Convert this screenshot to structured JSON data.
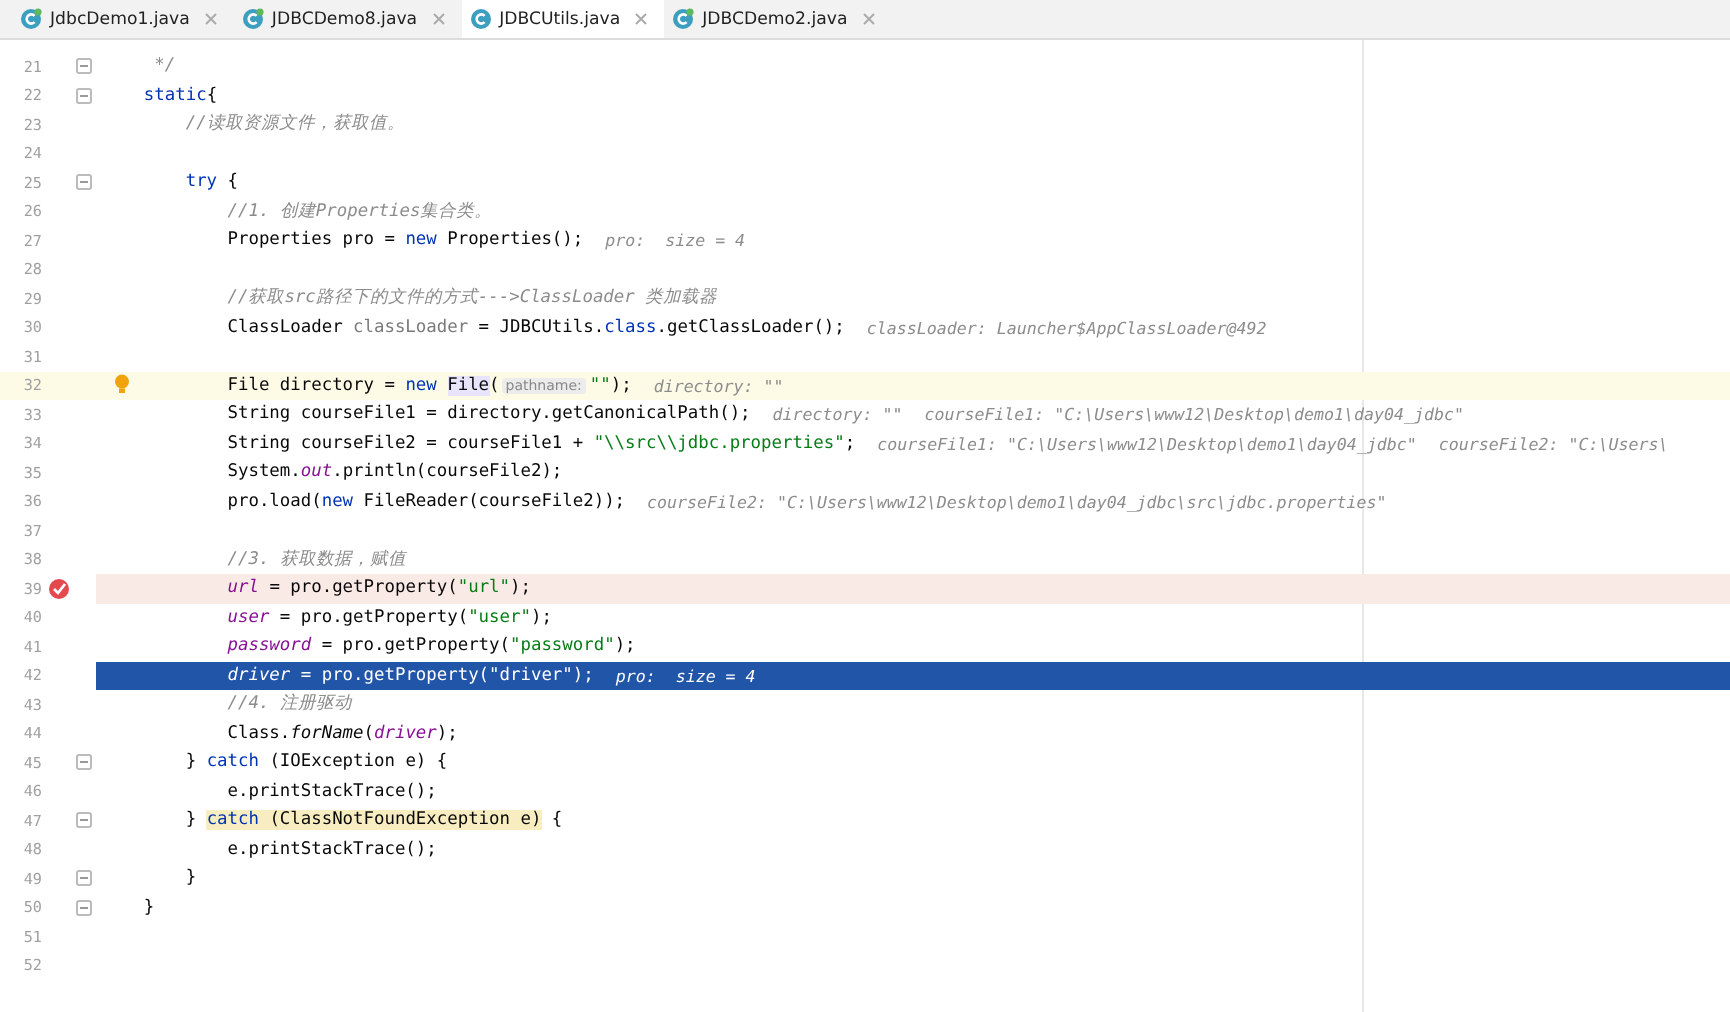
{
  "tabs": [
    {
      "label": "JdbcDemo1.java",
      "selected": false
    },
    {
      "label": "JDBCDemo8.java",
      "selected": false
    },
    {
      "label": "JDBCUtils.java",
      "selected": true
    },
    {
      "label": "JDBCDemo2.java",
      "selected": false
    }
  ],
  "lines": [
    {
      "number": "21",
      "fold": true,
      "tokens": [
        {
          "kind": "comment",
          "text": "     */"
        }
      ]
    },
    {
      "number": "22",
      "fold": true,
      "tokens": [
        {
          "kind": "keyword",
          "text": "    static"
        },
        {
          "kind": "plain",
          "text": "{"
        }
      ]
    },
    {
      "number": "23",
      "tokens": [
        {
          "kind": "comment",
          "text": "        //读取资源文件，获取值。"
        }
      ]
    },
    {
      "number": "24"
    },
    {
      "number": "25",
      "fold": true,
      "tokens": [
        {
          "kind": "keyword",
          "text": "        try"
        },
        {
          "kind": "plain",
          "text": " {"
        }
      ]
    },
    {
      "number": "26",
      "tokens": [
        {
          "kind": "comment",
          "text": "            //1. 创建Properties集合类。"
        }
      ]
    },
    {
      "number": "27",
      "tokens": [
        {
          "kind": "plain",
          "text": "            Properties pro = "
        },
        {
          "kind": "keyword",
          "text": "new"
        },
        {
          "kind": "plain",
          "text": " Properties();"
        },
        {
          "kind": "hint",
          "text": "pro:  size = 4"
        }
      ]
    },
    {
      "number": "28"
    },
    {
      "number": "29",
      "tokens": [
        {
          "kind": "comment",
          "text": "            //获取src路径下的文件的方式--->ClassLoader 类加载器"
        }
      ]
    },
    {
      "number": "30",
      "tokens": [
        {
          "kind": "plain",
          "text": "            ClassLoader "
        },
        {
          "kind": "unused",
          "text": "classLoader"
        },
        {
          "kind": "plain",
          "text": " = JDBCUtils."
        },
        {
          "kind": "keyword",
          "text": "class"
        },
        {
          "kind": "plain",
          "text": ".getClassLoader();"
        },
        {
          "kind": "hint",
          "text": "classLoader: Launcher$AppClassLoader@492"
        }
      ]
    },
    {
      "number": "31"
    },
    {
      "number": "32",
      "caret_line": true,
      "bulb": true,
      "tokens": [
        {
          "kind": "plain",
          "text": "            File directory = "
        },
        {
          "kind": "keyword",
          "text": "new "
        },
        {
          "kind": "match",
          "text": "File"
        },
        {
          "kind": "plain",
          "text": "("
        },
        {
          "kind": "param",
          "text": "pathname:"
        },
        {
          "kind": "string",
          "text": "\"\""
        },
        {
          "kind": "plain",
          "text": ");"
        },
        {
          "kind": "hint",
          "text": "directory: \"\""
        }
      ]
    },
    {
      "number": "33",
      "tokens": [
        {
          "kind": "plain",
          "text": "            String courseFile1 = directory.getCanonicalPath();"
        },
        {
          "kind": "hint",
          "text": "directory: \"\""
        },
        {
          "kind": "hint",
          "text": "courseFile1: \"C:\\Users\\www12\\Desktop\\demo1\\day04_jdbc\""
        }
      ]
    },
    {
      "number": "34",
      "tokens": [
        {
          "kind": "plain",
          "text": "            String courseFile2 = courseFile1 + "
        },
        {
          "kind": "string",
          "text": "\"\\\\src\\\\jdbc.properties\""
        },
        {
          "kind": "plain",
          "text": ";"
        },
        {
          "kind": "hint",
          "text": "courseFile1: \"C:\\Users\\www12\\Desktop\\demo1\\day04_jdbc\""
        },
        {
          "kind": "hint",
          "text": "courseFile2: \"C:\\Users\\"
        }
      ]
    },
    {
      "number": "35",
      "tokens": [
        {
          "kind": "plain",
          "text": "            System."
        },
        {
          "kind": "field",
          "text": "out"
        },
        {
          "kind": "plain",
          "text": ".println(courseFile2);"
        }
      ]
    },
    {
      "number": "36",
      "tokens": [
        {
          "kind": "plain",
          "text": "            pro.load("
        },
        {
          "kind": "keyword",
          "text": "new"
        },
        {
          "kind": "plain",
          "text": " FileReader(courseFile2));"
        },
        {
          "kind": "hint",
          "text": "courseFile2: \"C:\\Users\\www12\\Desktop\\demo1\\day04_jdbc\\src\\jdbc.properties\""
        }
      ]
    },
    {
      "number": "37"
    },
    {
      "number": "38",
      "tokens": [
        {
          "kind": "comment",
          "text": "            //3. 获取数据，赋值"
        }
      ]
    },
    {
      "number": "39",
      "breakpoint": true,
      "tokens": [
        {
          "kind": "field",
          "text": "            url"
        },
        {
          "kind": "plain",
          "text": " = pro.getProperty("
        },
        {
          "kind": "string",
          "text": "\"url\""
        },
        {
          "kind": "plain",
          "text": ");"
        }
      ]
    },
    {
      "number": "40",
      "tokens": [
        {
          "kind": "field",
          "text": "            user"
        },
        {
          "kind": "plain",
          "text": " = pro.getProperty("
        },
        {
          "kind": "string",
          "text": "\"user\""
        },
        {
          "kind": "plain",
          "text": ");"
        }
      ]
    },
    {
      "number": "41",
      "tokens": [
        {
          "kind": "field",
          "text": "            password"
        },
        {
          "kind": "plain",
          "text": " = pro.getProperty("
        },
        {
          "kind": "string",
          "text": "\"password\""
        },
        {
          "kind": "plain",
          "text": ");"
        }
      ]
    },
    {
      "number": "42",
      "execution_point": true,
      "tokens": [
        {
          "kind": "field",
          "text": "            driver"
        },
        {
          "kind": "plain",
          "text": " = pro.getProperty("
        },
        {
          "kind": "string",
          "text": "\"driver\""
        },
        {
          "kind": "plain",
          "text": ");"
        },
        {
          "kind": "hint",
          "text": "pro:  size = 4"
        }
      ]
    },
    {
      "number": "43",
      "tokens": [
        {
          "kind": "comment",
          "text": "            //4. 注册驱动"
        }
      ]
    },
    {
      "number": "44",
      "tokens": [
        {
          "kind": "plain",
          "text": "            Class."
        },
        {
          "kind": "static",
          "text": "forName"
        },
        {
          "kind": "plain",
          "text": "("
        },
        {
          "kind": "field",
          "text": "driver"
        },
        {
          "kind": "plain",
          "text": ");"
        }
      ]
    },
    {
      "number": "45",
      "fold": true,
      "tokens": [
        {
          "kind": "plain",
          "text": "        } "
        },
        {
          "kind": "keyword",
          "text": "catch"
        },
        {
          "kind": "plain",
          "text": " (IOException e) {"
        }
      ]
    },
    {
      "number": "46",
      "tokens": [
        {
          "kind": "plain",
          "text": "            e.printStackTrace();"
        }
      ]
    },
    {
      "number": "47",
      "fold": true,
      "tokens": [
        {
          "kind": "plain",
          "text": "        } "
        },
        {
          "kind": "keyword-match",
          "text": "catch"
        },
        {
          "kind": "match",
          "text": " (ClassNotFoundException e)"
        },
        {
          "kind": "plain",
          "text": " {"
        }
      ]
    },
    {
      "number": "48",
      "tokens": [
        {
          "kind": "plain",
          "text": "            e.printStackTrace();"
        }
      ]
    },
    {
      "number": "49",
      "fold": true,
      "tokens": [
        {
          "kind": "plain",
          "text": "        }"
        }
      ]
    },
    {
      "number": "50",
      "fold": true,
      "tokens": [
        {
          "kind": "plain",
          "text": "    }"
        }
      ]
    },
    {
      "number": "51"
    },
    {
      "number": "52"
    }
  ]
}
